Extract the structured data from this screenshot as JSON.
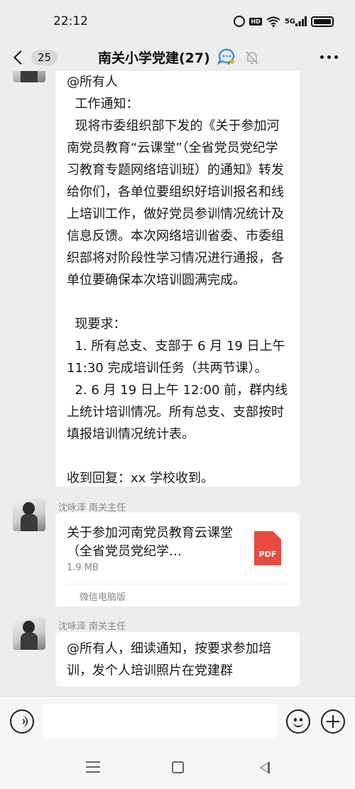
{
  "status_bar": {
    "time": "22:12",
    "icons": [
      "alarm-icon",
      "hd-icon",
      "wifi-icon",
      "5g-signal-icon",
      "battery-icon"
    ],
    "hd_label": "HD",
    "network_label": "5G"
  },
  "header": {
    "back_count": "25",
    "title": "南关小学党建(27)",
    "icons": [
      "chevron-left-icon",
      "group-chat-badge-icon",
      "mute-bell-icon",
      "more-dots-icon"
    ]
  },
  "messages": [
    {
      "type": "text",
      "text": "@所有人\n  工作通知：\n  现将市委组织部下发的《关于参加河南党员教育“云课堂”（全省党员党纪学习教育专题网络培训班）的通知》转发给你们，各单位要组织好培训报名和线上培训工作，做好党员参训情况统计及信息反馈。本次网络培训省委、市委组织部将对阶段性学习情况进行通报，各单位要确保本次培训圆满完成。\n\n  现要求：\n  1. 所有总支、支部于 6 月 19 日上午 11:30 完成培训任务（共两节课）。\n  2. 6 月 19 日上午 12:00 前，群内线上统计培训情况。所有总支、支部按时填报培训情况统计表。\n\n收到回复：xx 学校收到。"
    },
    {
      "type": "file",
      "sender": "沈咏泽  南关主任",
      "file_name": "关于参加河南党员教育云课堂（全省党员党纪学…",
      "file_size": "1.9 MB",
      "file_type_label": "PDF",
      "source": "微信电脑版"
    },
    {
      "type": "text",
      "sender": "沈咏泽  南关主任",
      "text": "@所有人，细读通知，按要求参加培训，发个人培训照片在党建群"
    }
  ],
  "input_bar": {
    "value": "",
    "icons": [
      "voice-icon",
      "emoji-icon",
      "plus-icon"
    ]
  },
  "nav_bar": {
    "icons": [
      "menu-icon",
      "home-icon",
      "back-triangle-icon"
    ]
  },
  "colors": {
    "background": "#ededed",
    "bubble": "#ffffff",
    "pdf": "#e94a40",
    "text": "#191919",
    "secondary_text": "#888888"
  }
}
